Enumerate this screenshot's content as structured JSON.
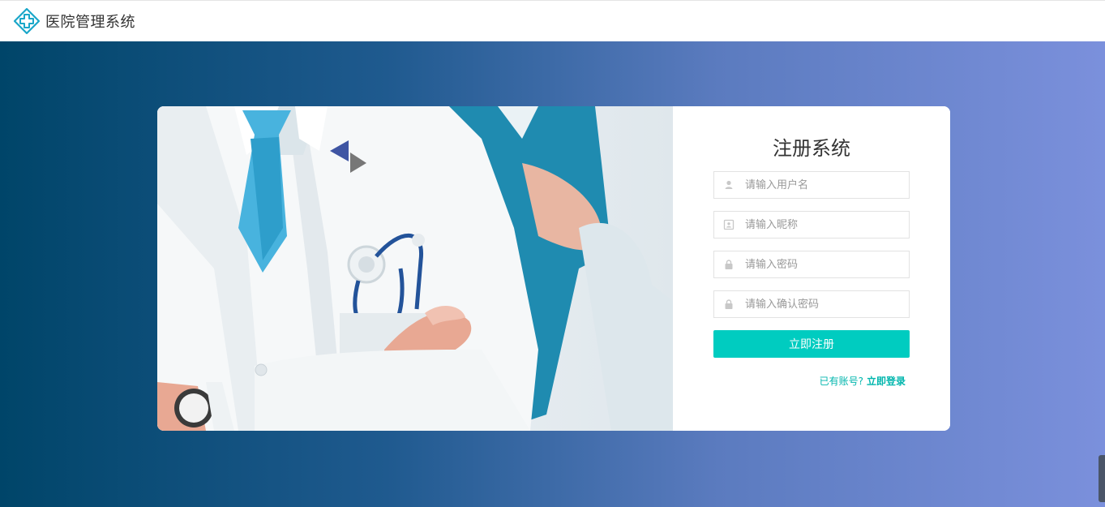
{
  "header": {
    "app_title": "医院管理系统",
    "logo_icon": "medical-cross-icon",
    "accent_color": "#1aa7c9"
  },
  "register": {
    "title": "注册系统",
    "username": {
      "placeholder": "请输入用户名",
      "icon": "user-icon"
    },
    "nickname": {
      "placeholder": "请输入昵称",
      "icon": "id-card-icon"
    },
    "password": {
      "placeholder": "请输入密码",
      "icon": "lock-icon"
    },
    "confirm_password": {
      "placeholder": "请输入确认密码",
      "icon": "lock-icon"
    },
    "submit_label": "立即注册",
    "submit_color": "#00ccc0",
    "has_account_text": "已有账号?",
    "login_link_text": "立即登录"
  },
  "hero_image": {
    "description_icon": "doctor-illustration"
  }
}
